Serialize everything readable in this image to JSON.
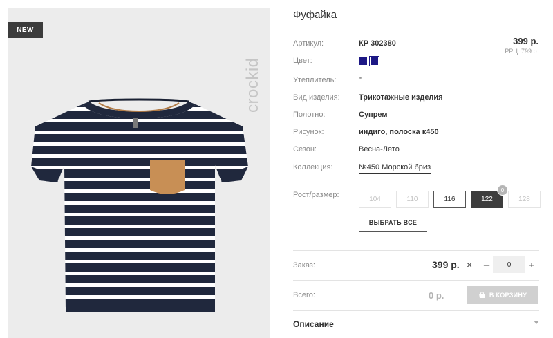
{
  "product": {
    "title": "Фуфайка",
    "badge": "NEW",
    "brand": "crockid",
    "price": "399 р.",
    "rrp": "РРЦ: 799 р."
  },
  "specs": {
    "article_label": "Артикул:",
    "article_value": "КР 302380",
    "color_label": "Цвет:",
    "colors": [
      "#1d1885",
      "#1d1885"
    ],
    "insulation_label": "Утеплитель:",
    "insulation_value": "\"",
    "type_label": "Вид изделия:",
    "type_value": "Трикотажные изделия",
    "fabric_label": "Полотно:",
    "fabric_value": "Супрем",
    "pattern_label": "Рисунок:",
    "pattern_value": "индиго, полоска к450",
    "season_label": "Сезон:",
    "season_value": "Весна-Лето",
    "collection_label": "Коллекция:",
    "collection_value": "№450 Морской бриз",
    "size_label": "Рост/размер:"
  },
  "sizes": [
    {
      "label": "104",
      "state": "unavailable"
    },
    {
      "label": "110",
      "state": "unavailable"
    },
    {
      "label": "116",
      "state": "available"
    },
    {
      "label": "122",
      "state": "selected",
      "qty": "0"
    },
    {
      "label": "128",
      "state": "unavailable"
    }
  ],
  "select_all_label": "ВЫБРАТЬ ВСЕ",
  "order": {
    "label": "Заказ:",
    "price": "399 р.",
    "qty": "0"
  },
  "total": {
    "label": "Всего:",
    "value": "0 р.",
    "cart_button": "В КОРЗИНУ"
  },
  "description_label": "Описание",
  "shirt": {
    "navy": "#20283d",
    "pocket": "#c88f55"
  }
}
